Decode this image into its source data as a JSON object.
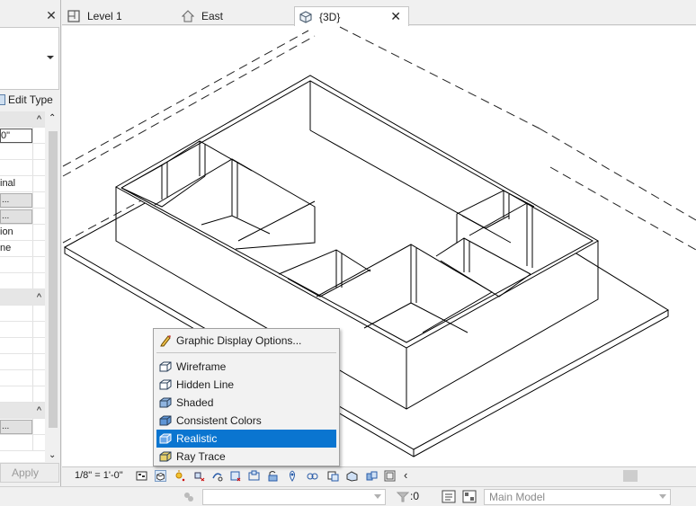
{
  "properties_palette": {
    "edit_type_label": "Edit Type",
    "rows": [
      {
        "kind": "header",
        "text": ""
      },
      {
        "kind": "input",
        "text": "0\""
      },
      {
        "kind": "text",
        "text": ""
      },
      {
        "kind": "text",
        "text": ""
      },
      {
        "kind": "text",
        "text": "inal"
      },
      {
        "kind": "button",
        "text": "..."
      },
      {
        "kind": "button",
        "text": "..."
      },
      {
        "kind": "text",
        "text": "ion"
      },
      {
        "kind": "text",
        "text": "ne"
      },
      {
        "kind": "text",
        "text": ""
      },
      {
        "kind": "text",
        "text": ""
      },
      {
        "kind": "header",
        "text": ""
      },
      {
        "kind": "text",
        "text": ""
      },
      {
        "kind": "text",
        "text": ""
      },
      {
        "kind": "text",
        "text": ""
      },
      {
        "kind": "text",
        "text": ""
      },
      {
        "kind": "text",
        "text": ""
      },
      {
        "kind": "text",
        "text": ""
      },
      {
        "kind": "header",
        "text": ""
      },
      {
        "kind": "button",
        "text": "..."
      },
      {
        "kind": "text",
        "text": ""
      }
    ],
    "apply_label": "Apply"
  },
  "tabs": [
    {
      "label": "Level 1",
      "icon": "floor-plan-icon",
      "active": false
    },
    {
      "label": "East",
      "icon": "elevation-icon",
      "active": false
    },
    {
      "label": "{3D}",
      "icon": "3d-view-icon",
      "active": true
    }
  ],
  "view_control_bar": {
    "scale": "1/8\" = 1'-0\""
  },
  "visual_style_menu": {
    "graphic_display_options": "Graphic Display Options...",
    "items": [
      {
        "label": "Wireframe",
        "selected": false
      },
      {
        "label": "Hidden Line",
        "selected": false
      },
      {
        "label": "Shaded",
        "selected": false
      },
      {
        "label": "Consistent Colors",
        "selected": false
      },
      {
        "label": "Realistic",
        "selected": true
      },
      {
        "label": "Ray Trace",
        "selected": false
      }
    ]
  },
  "status_bar": {
    "selection_count": ":0",
    "model_selector": "Main Model"
  },
  "colors": {
    "selection_blue": "#0a75d0",
    "panel_gray": "#f0f0f0"
  }
}
